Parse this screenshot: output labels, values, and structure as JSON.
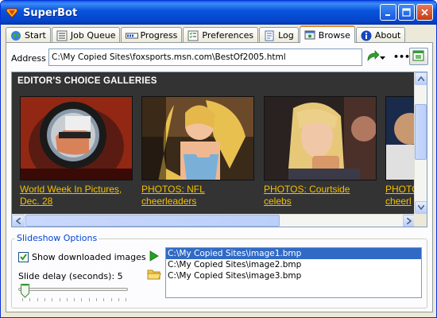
{
  "window": {
    "title": "SuperBot"
  },
  "tabs": [
    {
      "label": "Start",
      "icon": "globe-icon"
    },
    {
      "label": "Job Queue",
      "icon": "list-icon"
    },
    {
      "label": "Progress",
      "icon": "progress-icon"
    },
    {
      "label": "Preferences",
      "icon": "checklist-icon"
    },
    {
      "label": "Log",
      "icon": "log-icon"
    },
    {
      "label": "Browse",
      "icon": "browse-icon",
      "active": true
    },
    {
      "label": "About",
      "icon": "info-icon"
    }
  ],
  "address": {
    "label": "Address",
    "value": "C:\\My Copied Sites\\foxsports.msn.com\\BestOf2005.html"
  },
  "browser": {
    "header": "EDITOR'S CHOICE GALLERIES",
    "galleries": [
      {
        "caption_line1": "World Week In Pictures,",
        "caption_line2": "Dec. 28"
      },
      {
        "caption_line1": "PHOTOS: NFL",
        "caption_line2": "cheerleaders"
      },
      {
        "caption_line1": "PHOTOS: Courtside",
        "caption_line2": "celebs"
      },
      {
        "caption_line1": "PHOTO",
        "caption_line2": "cheerl"
      }
    ]
  },
  "slideshow": {
    "group_title": "Slideshow Options",
    "show_downloaded_label": "Show downloaded images",
    "show_downloaded_checked": true,
    "delay_label": "Slide delay (seconds):",
    "delay_value": "5",
    "files": [
      "C:\\My Copied Sites\\image1.bmp",
      "C:\\My Copied Sites\\image2.bmp",
      "C:\\My Copied Sites\\image3.bmp"
    ],
    "selected_index": 0
  },
  "colors": {
    "link": "#f5c000",
    "selection": "#316ac5",
    "group_title": "#0046d5"
  }
}
